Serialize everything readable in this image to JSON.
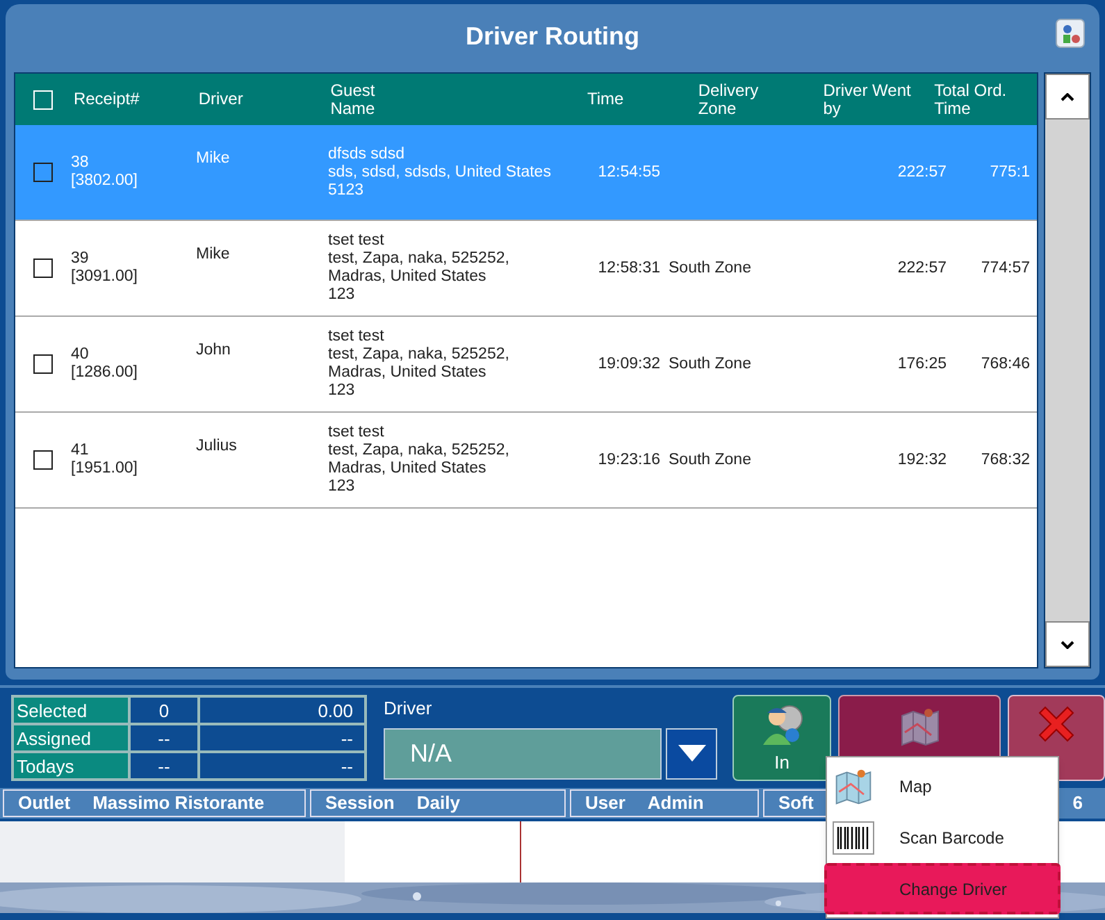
{
  "window": {
    "title": "Driver Routing"
  },
  "table": {
    "select_all": {
      "checked": false
    },
    "columns": [
      "Receipt#",
      "Driver",
      "Guest Name",
      "Time",
      "Delivery Zone",
      "Driver Went by",
      "Total Ord. Time"
    ],
    "rows": [
      {
        "selected": true,
        "checked": false,
        "receipt": "38",
        "amount": "[3802.00]",
        "driver": "Mike",
        "guest": [
          "dfsds sdsd",
          "sds, sdsd, sdsds, United States",
          "5123"
        ],
        "time": "12:54:55",
        "zone": "",
        "went_by": "222:57",
        "total": "775:1"
      },
      {
        "selected": false,
        "checked": false,
        "receipt": "39",
        "amount": "[3091.00]",
        "driver": "Mike",
        "guest": [
          "tset test",
          "test, Zapa, naka, 525252,",
          "Madras, United States",
          "123"
        ],
        "time": "12:58:31",
        "zone": "South Zone",
        "went_by": "222:57",
        "total": "774:57"
      },
      {
        "selected": false,
        "checked": false,
        "receipt": "40",
        "amount": "[1286.00]",
        "driver": "John",
        "guest": [
          "tset test",
          "test, Zapa, naka, 525252,",
          "Madras, United States",
          "123"
        ],
        "time": "19:09:32",
        "zone": "South Zone",
        "went_by": "176:25",
        "total": "768:46"
      },
      {
        "selected": false,
        "checked": false,
        "receipt": "41",
        "amount": "[1951.00]",
        "driver": "Julius",
        "guest": [
          "tset test",
          "test, Zapa, naka, 525252,",
          "Madras, United States",
          "123"
        ],
        "time": "19:23:16",
        "zone": "South Zone",
        "went_by": "192:32",
        "total": "768:32"
      }
    ]
  },
  "summary": [
    {
      "label": "Selected",
      "count": "0",
      "amount": "0.00"
    },
    {
      "label": "Assigned",
      "count": "--",
      "amount": "--"
    },
    {
      "label": "Todays",
      "count": "--",
      "amount": "--"
    }
  ],
  "driver": {
    "label": "Driver",
    "value": "N/A"
  },
  "buttons": [
    {
      "kind": "in",
      "label": "In"
    },
    {
      "kind": "map"
    },
    {
      "kind": "close"
    }
  ],
  "menu": [
    {
      "kind": "map",
      "label": "Map",
      "selected": false
    },
    {
      "kind": "barcode",
      "label": "Scan Barcode",
      "selected": false
    },
    {
      "kind": "plain",
      "label": "Change Driver",
      "selected": true
    }
  ],
  "status_bar": [
    {
      "label": "Outlet",
      "value": "Massimo Ristorante"
    },
    {
      "label": "Session",
      "value": "Daily"
    },
    {
      "label": "User",
      "value": "Admin"
    },
    {
      "label": "Soft"
    }
  ],
  "status_tail": "6"
}
